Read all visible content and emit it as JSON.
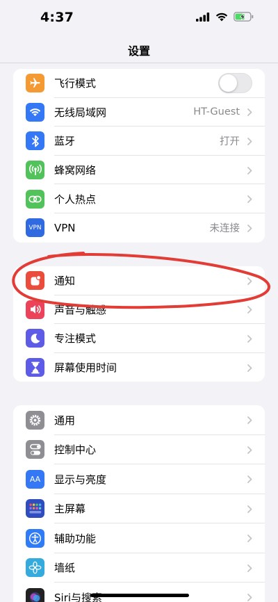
{
  "status_bar": {
    "time": "4:37"
  },
  "header": {
    "title": "设置"
  },
  "groups": [
    {
      "rows": [
        {
          "label": "飞行模式",
          "icon": "airplane-icon",
          "color": "#f49a32",
          "control": "toggle",
          "toggle_on": false
        },
        {
          "label": "无线局域网",
          "icon": "wifi-icon",
          "color": "#3478f6",
          "value": "HT-Guest"
        },
        {
          "label": "蓝牙",
          "icon": "bluetooth-icon",
          "color": "#3478f6",
          "value": "打开"
        },
        {
          "label": "蜂窝网络",
          "icon": "cellular-icon",
          "color": "#52c35a"
        },
        {
          "label": "个人热点",
          "icon": "hotspot-icon",
          "color": "#52c35a"
        },
        {
          "label": "VPN",
          "icon": "vpn-icon",
          "color": "#2f6ae0",
          "icon_text": "VPN",
          "value": "未连接"
        }
      ]
    },
    {
      "rows": [
        {
          "label": "通知",
          "icon": "notifications-icon",
          "color": "#eb4d3d"
        },
        {
          "label": "声音与触感",
          "icon": "sounds-icon",
          "color": "#eb445a"
        },
        {
          "label": "专注模式",
          "icon": "focus-moon-icon",
          "color": "#5e5ce6"
        },
        {
          "label": "屏幕使用时间",
          "icon": "screen-time-icon",
          "color": "#5e5ce6"
        }
      ]
    },
    {
      "rows": [
        {
          "label": "通用",
          "icon": "general-gear-icon",
          "color": "#8e8e93"
        },
        {
          "label": "控制中心",
          "icon": "control-center-icon",
          "color": "#8e8e93"
        },
        {
          "label": "显示与亮度",
          "icon": "display-brightness-icon",
          "color": "#3478f6",
          "icon_text": "AA"
        },
        {
          "label": "主屏幕",
          "icon": "home-screen-icon",
          "color": "#2f4dbf"
        },
        {
          "label": "辅助功能",
          "icon": "accessibility-icon",
          "color": "#2f7cf6"
        },
        {
          "label": "墙纸",
          "icon": "wallpaper-icon",
          "color": "#35aadc"
        },
        {
          "label": "Siri与搜索",
          "icon": "siri-icon",
          "color": "#222"
        }
      ]
    }
  ]
}
